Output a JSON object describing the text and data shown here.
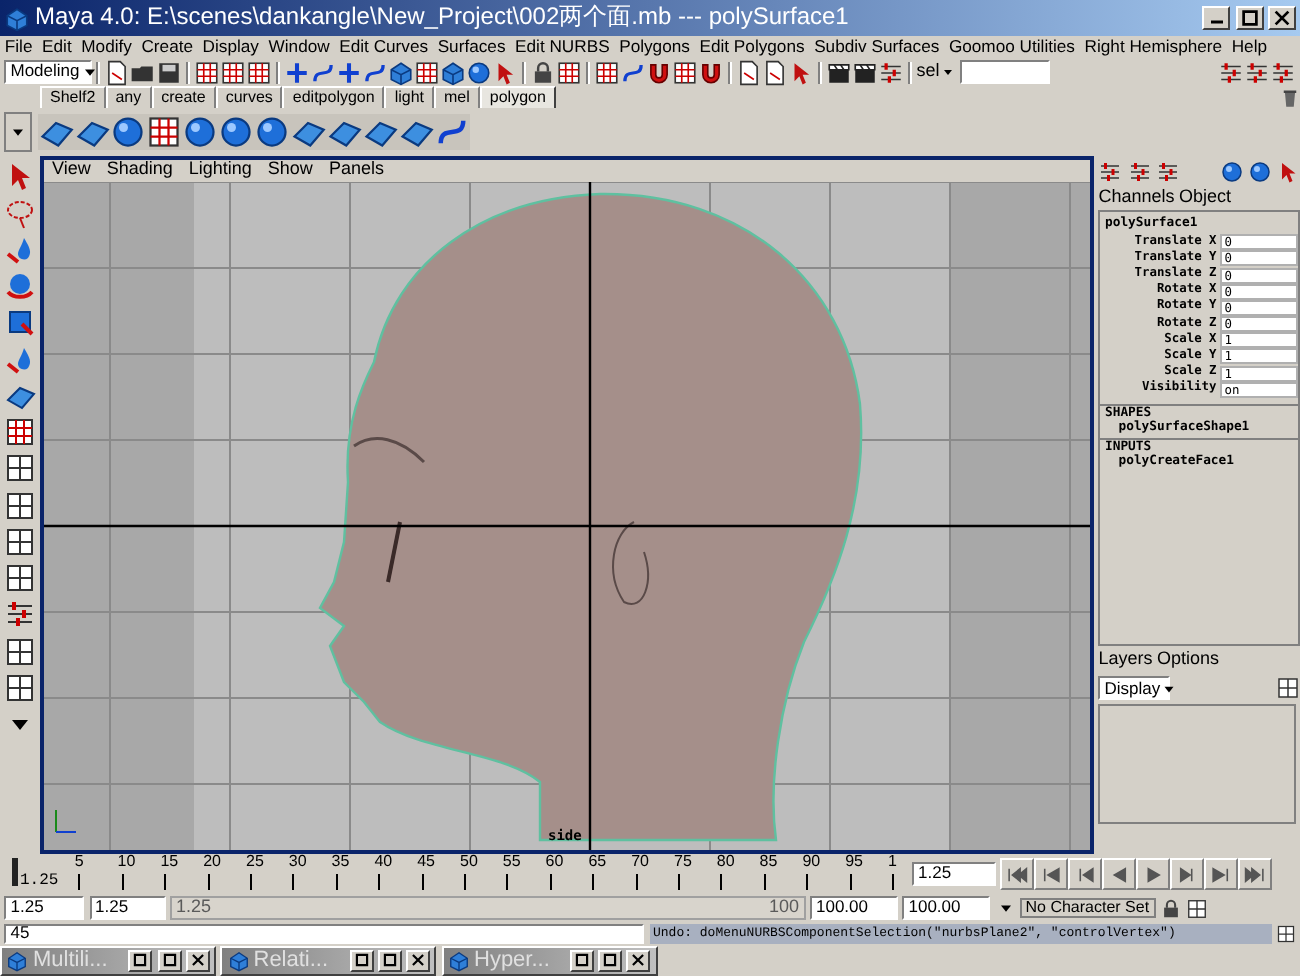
{
  "window": {
    "title": "Maya 4.0: E:\\scenes\\dankangle\\New_Project\\002两个面.mb   ---   polySurface1"
  },
  "menu": [
    "File",
    "Edit",
    "Modify",
    "Create",
    "Display",
    "Window",
    "Edit Curves",
    "Surfaces",
    "Edit NURBS",
    "Polygons",
    "Edit Polygons",
    "Subdiv Surfaces",
    "Goomoo Utilities",
    "Right Hemisphere",
    "Help"
  ],
  "status_line": {
    "mode": "Modeling",
    "sel_label": "sel"
  },
  "shelf_tabs": [
    {
      "label": "Shelf2",
      "selected": false
    },
    {
      "label": "any",
      "selected": false
    },
    {
      "label": "create",
      "selected": false
    },
    {
      "label": "curves",
      "selected": false
    },
    {
      "label": "editpolygon",
      "selected": false
    },
    {
      "label": "light",
      "selected": false
    },
    {
      "label": "mel",
      "selected": false
    },
    {
      "label": "polygon",
      "selected": true
    }
  ],
  "viewport": {
    "menu": [
      "View",
      "Shading",
      "Lighting",
      "Show",
      "Panels"
    ],
    "camera": "side"
  },
  "channel_box": {
    "tabs": [
      "Channels",
      "Object"
    ],
    "node": "polySurface1",
    "attributes": [
      {
        "name": "Translate X",
        "value": "0"
      },
      {
        "name": "Translate Y",
        "value": "0"
      },
      {
        "name": "Translate Z",
        "value": "0"
      },
      {
        "name": "Rotate X",
        "value": "0"
      },
      {
        "name": "Rotate Y",
        "value": "0"
      },
      {
        "name": "Rotate Z",
        "value": "0"
      },
      {
        "name": "Scale X",
        "value": "1"
      },
      {
        "name": "Scale Y",
        "value": "1"
      },
      {
        "name": "Scale Z",
        "value": "1"
      },
      {
        "name": "Visibility",
        "value": "on"
      }
    ],
    "shapes_heading": "SHAPES",
    "shapes": [
      "polySurfaceShape1"
    ],
    "inputs_heading": "INPUTS",
    "inputs": [
      "polyCreateFace1"
    ]
  },
  "layers": {
    "menu": [
      "Layers",
      "Options"
    ],
    "mode": "Display"
  },
  "time_slider": {
    "ticks": [
      "5",
      "10",
      "15",
      "20",
      "25",
      "30",
      "35",
      "40",
      "45",
      "50",
      "55",
      "60",
      "65",
      "70",
      "75",
      "80",
      "85",
      "90",
      "95",
      "1"
    ],
    "current": "1.25",
    "current_field": "1.25"
  },
  "range_slider": {
    "level": 1,
    "start": "1.25",
    "range_start": "1.25",
    "slider_start": "1.25",
    "slider_end": "100",
    "range_end": "100.00",
    "end": "100.00",
    "character_set": "No Character Set"
  },
  "command_line": {
    "input": "45",
    "feedback": "Undo: doMenuNURBSComponentSelection(\"nurbsPlane2\", \"controlVertex\")"
  },
  "taskbar": [
    {
      "label": "Multili..."
    },
    {
      "label": "Relati..."
    },
    {
      "label": "Hyper..."
    }
  ]
}
